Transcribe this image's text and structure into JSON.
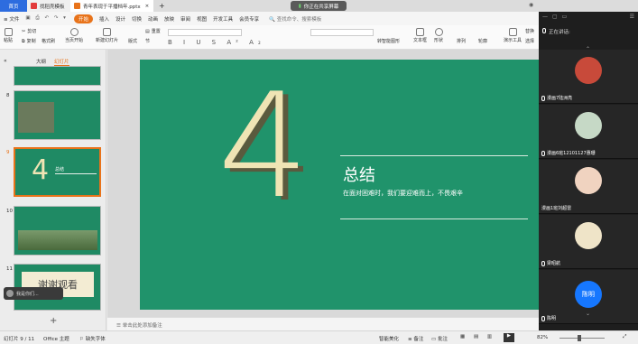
{
  "titlebar": {
    "tabs": [
      {
        "label": "首页",
        "kind": "home"
      },
      {
        "label": "找稻壳模板",
        "kind": "doc"
      },
      {
        "label": "青年表现于平播档年.pptx",
        "kind": "ppt"
      }
    ],
    "share_label": "你正在共享屏幕"
  },
  "menubar": {
    "file_label": "文件",
    "items": [
      "开始",
      "插入",
      "设计",
      "切换",
      "动画",
      "放映",
      "审阅",
      "视图",
      "开发工具",
      "会员专享"
    ],
    "active": "开始",
    "search_placeholder": "查找命令、搜索模板"
  },
  "ribbon": {
    "paste": "粘贴",
    "cut": "剪切",
    "copy": "复制",
    "format_painter": "格式刷",
    "play_from_current": "当页开始",
    "new_slide": "新建幻灯片",
    "layout": "版式",
    "section": "节",
    "reset": "重置",
    "textbox": "文本框",
    "shape": "形状",
    "arrange": "排列",
    "outline": "轮廓",
    "presentation_tool": "演示工具",
    "replace": "替换",
    "select": "选择",
    "convert_smartart": "转智能图形"
  },
  "leftpanel": {
    "tab_outline": "大纲",
    "tab_slides": "幻灯片",
    "slides": [
      {
        "num": "8"
      },
      {
        "num": "9",
        "big": "4",
        "caption": "总结"
      },
      {
        "num": "10"
      },
      {
        "num": "11",
        "caption": "谢谢观看"
      }
    ],
    "add_label": "+",
    "assistant_tip": "我是你们..."
  },
  "slide": {
    "big_number": "4",
    "title": "总结",
    "subtitle": "在面对困难时，我们要迎难而上，不畏艰辛"
  },
  "notes": {
    "placeholder": "单击此处添加备注"
  },
  "statusbar": {
    "slide_count": "幻灯片 9 / 11",
    "theme": "Office 主题",
    "missing_font": "缺失字体",
    "smart_beautify": "智能美化",
    "notes_btn": "备注",
    "comments_btn": "批注",
    "zoom": "82%"
  },
  "meeting": {
    "speaking_label": "正在讲话:",
    "participants": [
      {
        "name": "漫画7陆洲亮",
        "color": "#c84a3a"
      },
      {
        "name": "漫画6班12101127惠珊",
        "color": "#c6d9c6"
      },
      {
        "name": "漫画1班刘超雷",
        "color": "#f0d3c0"
      },
      {
        "name": "梁昭航",
        "color": "#efe4c8"
      },
      {
        "name": "陈明",
        "color": "#1677ff",
        "initials": "陈明"
      }
    ]
  },
  "colors": {
    "slide_green": "#20936b",
    "accent_orange": "#e8731a",
    "number_cream": "#efe4b4",
    "number_shadow": "#5a5a3e"
  }
}
